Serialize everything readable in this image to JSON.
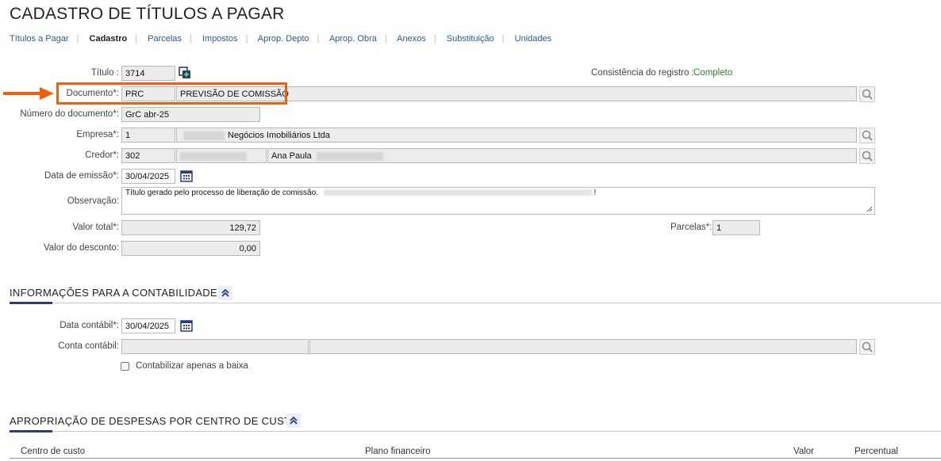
{
  "page_title": "CADASTRO DE TÍTULOS A PAGAR",
  "tabs": [
    "Títulos a Pagar",
    "Cadastro",
    "Parcelas",
    "Impostos",
    "Aprop. Depto",
    "Aprop. Obra",
    "Anexos",
    "Substituição",
    "Unidades"
  ],
  "active_tab": "Cadastro",
  "form": {
    "titulo_label": "Título :",
    "titulo_value": "3714",
    "consistencia_label": "Consistência do registro :",
    "consistencia_value": "Completo",
    "documento_label": "Documento*:",
    "documento_code": "PRC",
    "documento_desc": "PREVISÃO DE COMISSÃO",
    "numero_doc_label": "Número do documento*:",
    "numero_doc_value": "GrC abr-25",
    "empresa_label": "Empresa*:",
    "empresa_code": "1",
    "empresa_name": "Negócios Imobiliários Ltda",
    "credor_label": "Credor*:",
    "credor_code": "302",
    "credor_name": "Ana Paula",
    "data_emissao_label": "Data de emissão*:",
    "data_emissao_value": "30/04/2025",
    "observacao_label": "Observação:",
    "observacao_value": "Título gerado pelo processo de liberação de comissão.",
    "observacao_end": "!",
    "valor_total_label": "Valor total*:",
    "valor_total_value": "129,72",
    "parcelas_label": "Parcelas*:",
    "parcelas_value": "1",
    "valor_desconto_label": "Valor do desconto:",
    "valor_desconto_value": "0,00"
  },
  "contabilidade": {
    "section_title": "INFORMAÇÕES PARA A CONTABILIDADE",
    "data_contabil_label": "Data contábil*:",
    "data_contabil_value": "30/04/2025",
    "conta_contabil_label": "Conta contábil:",
    "contabilizar_label": "Contabilizar apenas a baixa"
  },
  "apropriacao": {
    "section_title": "APROPRIAÇÃO DE DESPESAS POR CENTRO DE CUSTO",
    "columns": [
      "Centro de custo",
      "Plano financeiro",
      "Valor",
      "Percentual"
    ]
  },
  "colors": {
    "highlight": "#f25d0e",
    "link": "#2b5a8f",
    "status_ok": "#2e7d32",
    "accent": "#2a3c7a"
  }
}
